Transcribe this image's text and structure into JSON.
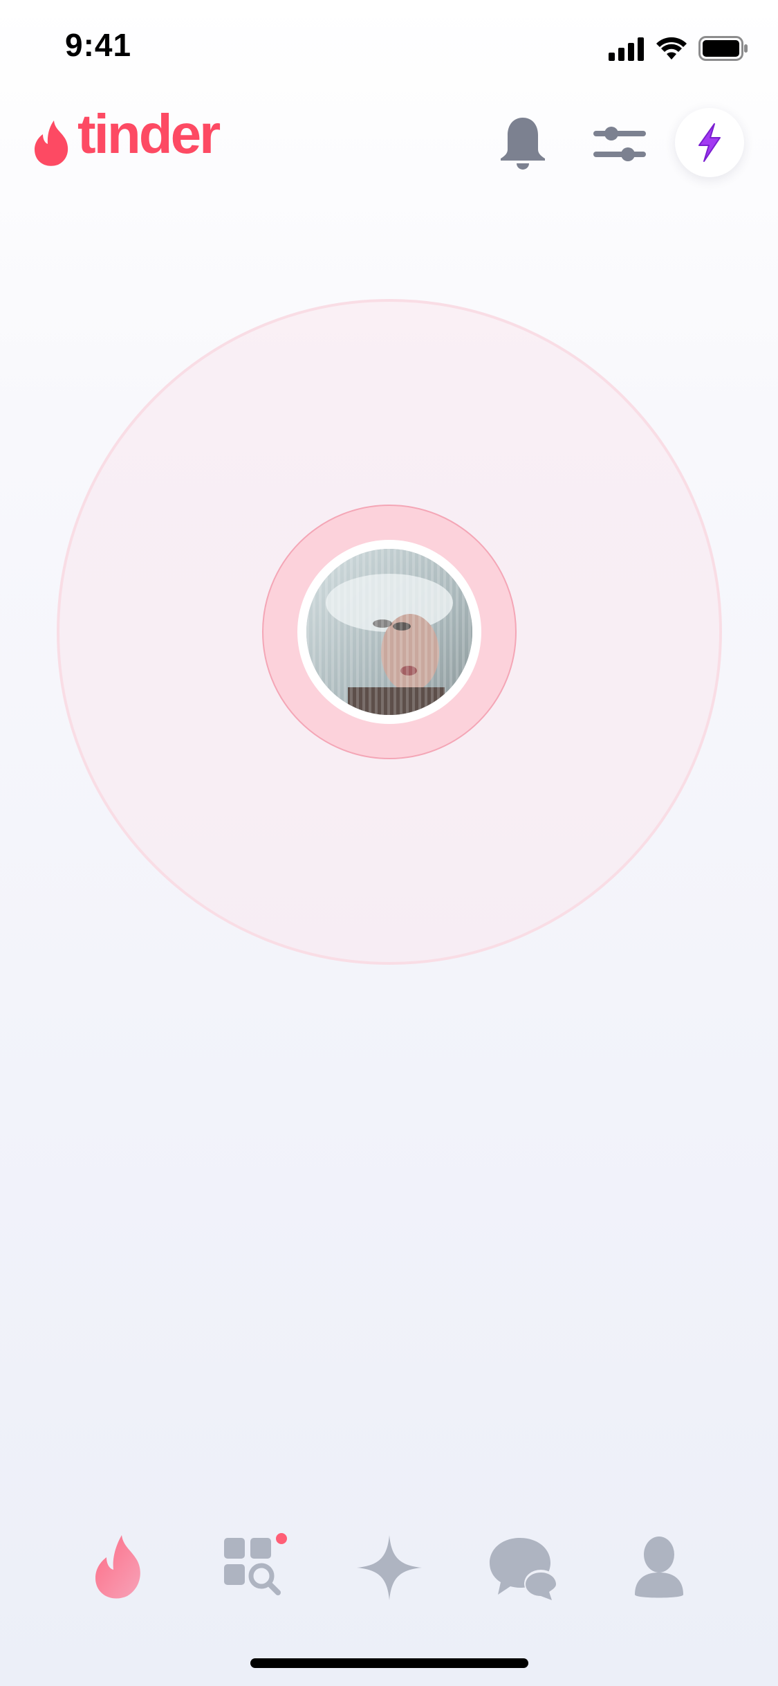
{
  "status_bar": {
    "time": "9:41",
    "icons": [
      "cellular-signal-icon",
      "wifi-icon",
      "battery-icon"
    ]
  },
  "header": {
    "logo_text": "tinder",
    "logo_icon": "flame-icon",
    "buttons": [
      {
        "name": "notifications",
        "icon": "bell-icon"
      },
      {
        "name": "discovery-filters",
        "icon": "sliders-icon"
      },
      {
        "name": "boost",
        "icon": "lightning-bolt-icon"
      }
    ]
  },
  "radar": {
    "center_image": "user-profile-photo"
  },
  "bottom_nav": {
    "tabs": [
      {
        "name": "home",
        "icon": "flame-icon",
        "active": true
      },
      {
        "name": "explore",
        "icon": "explore-grid-search-icon",
        "badge_dot": true
      },
      {
        "name": "gold-likes",
        "icon": "sparkle-star-icon",
        "active": false
      },
      {
        "name": "messages",
        "icon": "chat-bubbles-icon",
        "active": false
      },
      {
        "name": "profile",
        "icon": "person-icon",
        "active": false
      }
    ]
  },
  "colors": {
    "brand": "#fd4a63",
    "icon_inactive": "#aeb4c1",
    "header_icon": "#7c8190",
    "boost_purple": "#a23af2",
    "badge": "#ff5e76"
  }
}
